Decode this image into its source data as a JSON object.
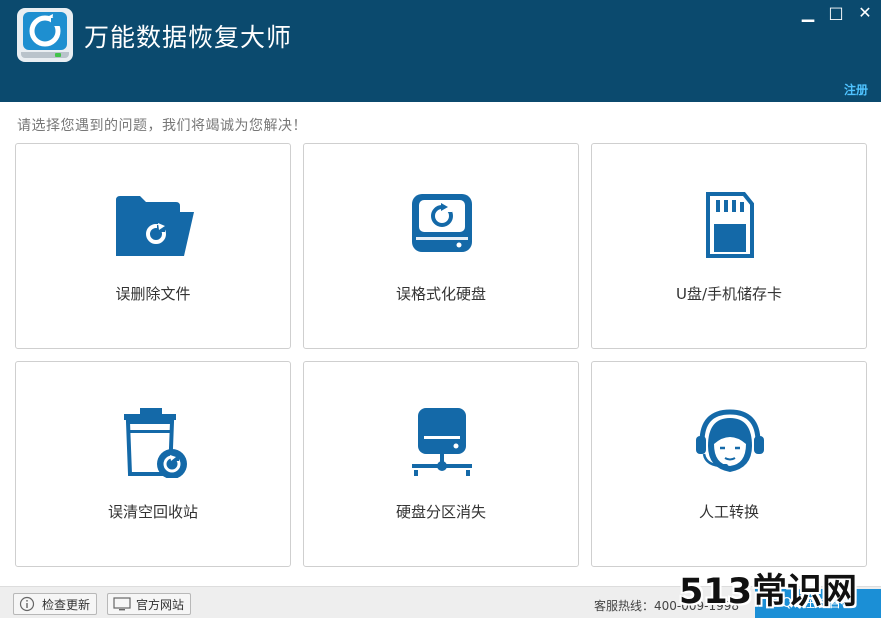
{
  "app": {
    "title": "万能数据恢复大师",
    "register_link": "注册"
  },
  "window_controls": {
    "minimize": "▁",
    "maximize": "□",
    "close": "✕"
  },
  "prompt": "请选择您遇到的问题，我们将竭诚为您解决！",
  "options": [
    {
      "label": "误删除文件",
      "icon": "deleted-file-folder-icon"
    },
    {
      "label": "误格式化硬盘",
      "icon": "format-disk-icon"
    },
    {
      "label": "U盘/手机储存卡",
      "icon": "sd-card-icon"
    },
    {
      "label": "误清空回收站",
      "icon": "recycle-bin-icon"
    },
    {
      "label": "硬盘分区消失",
      "icon": "disk-partition-icon"
    },
    {
      "label": "人工转换",
      "icon": "customer-service-icon"
    }
  ],
  "footer": {
    "check_update": "检查更新",
    "official_site": "官方网站",
    "hotline": "客服热线：400-009-1998",
    "online_consult": "QQ在线咨询"
  },
  "watermark": "513常识网",
  "colors": {
    "titlebar": "#0b4a6e",
    "icon_blue": "#1469a8",
    "accent": "#1b8fd6"
  }
}
